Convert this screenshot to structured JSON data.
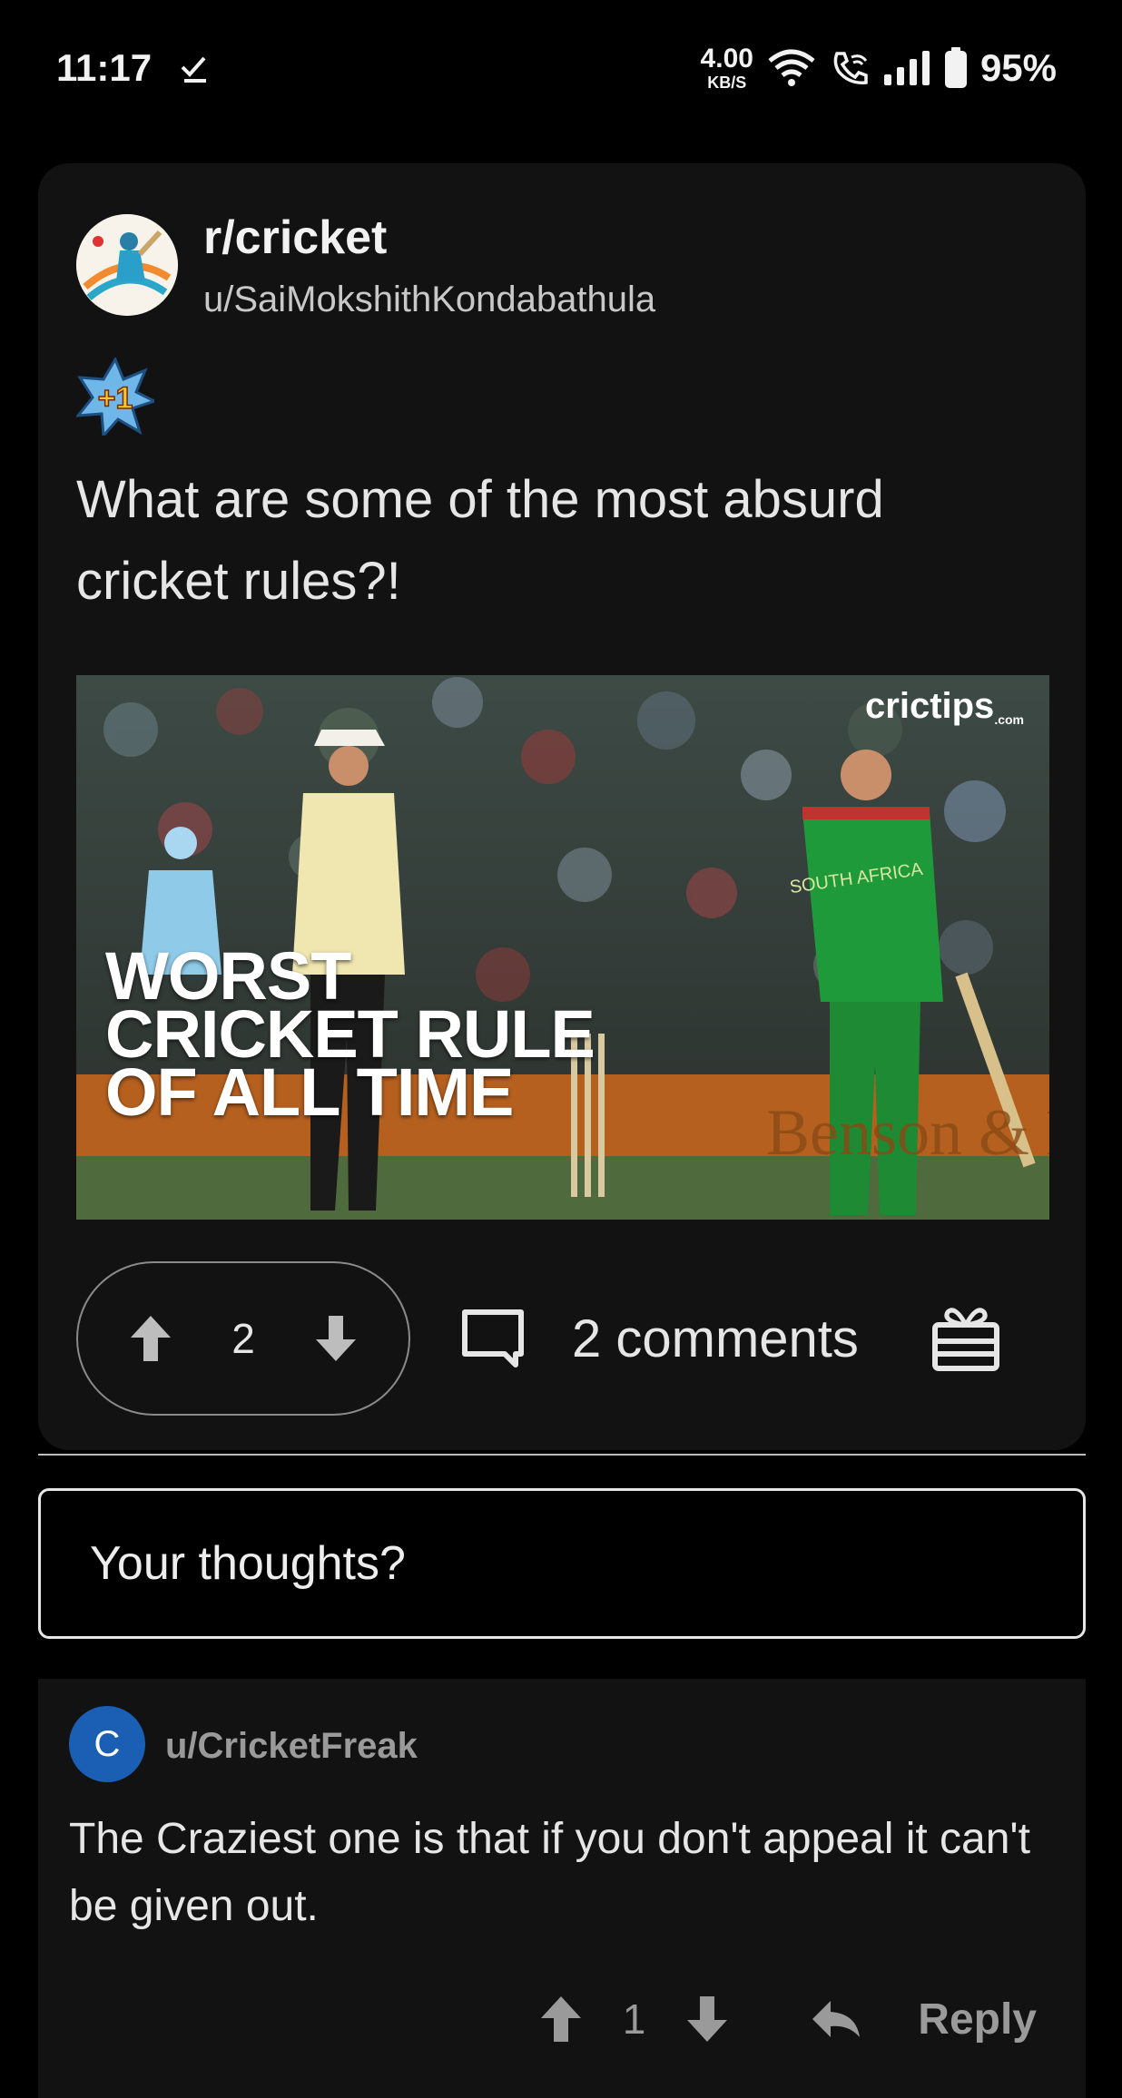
{
  "status_bar": {
    "time": "11:17",
    "net_speed_value": "4.00",
    "net_speed_unit": "KB/S",
    "battery": "95%",
    "icons": [
      "download-done-icon",
      "wifi-icon",
      "wifi-call-icon",
      "signal-icon",
      "battery-icon"
    ]
  },
  "post": {
    "subreddit": "r/cricket",
    "author": "u/SaiMokshithKondabathula",
    "award_text": "+1",
    "title": "What are some of the most absurd cricket rules?!",
    "thumbnail": {
      "brand": "crictips",
      "brand_sub": ".com",
      "headline_lines": [
        "WORST",
        "CRICKET RULE",
        "OF ALL TIME"
      ],
      "jersey_text": "SOUTH AFRICA",
      "board_text": "Benson & Hedges World"
    },
    "votes": "2",
    "comments_label": "2 comments"
  },
  "reply_box": {
    "placeholder": "Your thoughts?"
  },
  "comment": {
    "avatar_letter": "C",
    "avatar_color": "#1a5fb4",
    "user": "u/CricketFreak",
    "body": "The Craziest one is that if you don't appeal it can't be given out.",
    "votes": "1",
    "reply_label": "Reply"
  },
  "colors": {
    "background": "#000000",
    "card": "#121212",
    "muted": "#9a9a9a"
  }
}
